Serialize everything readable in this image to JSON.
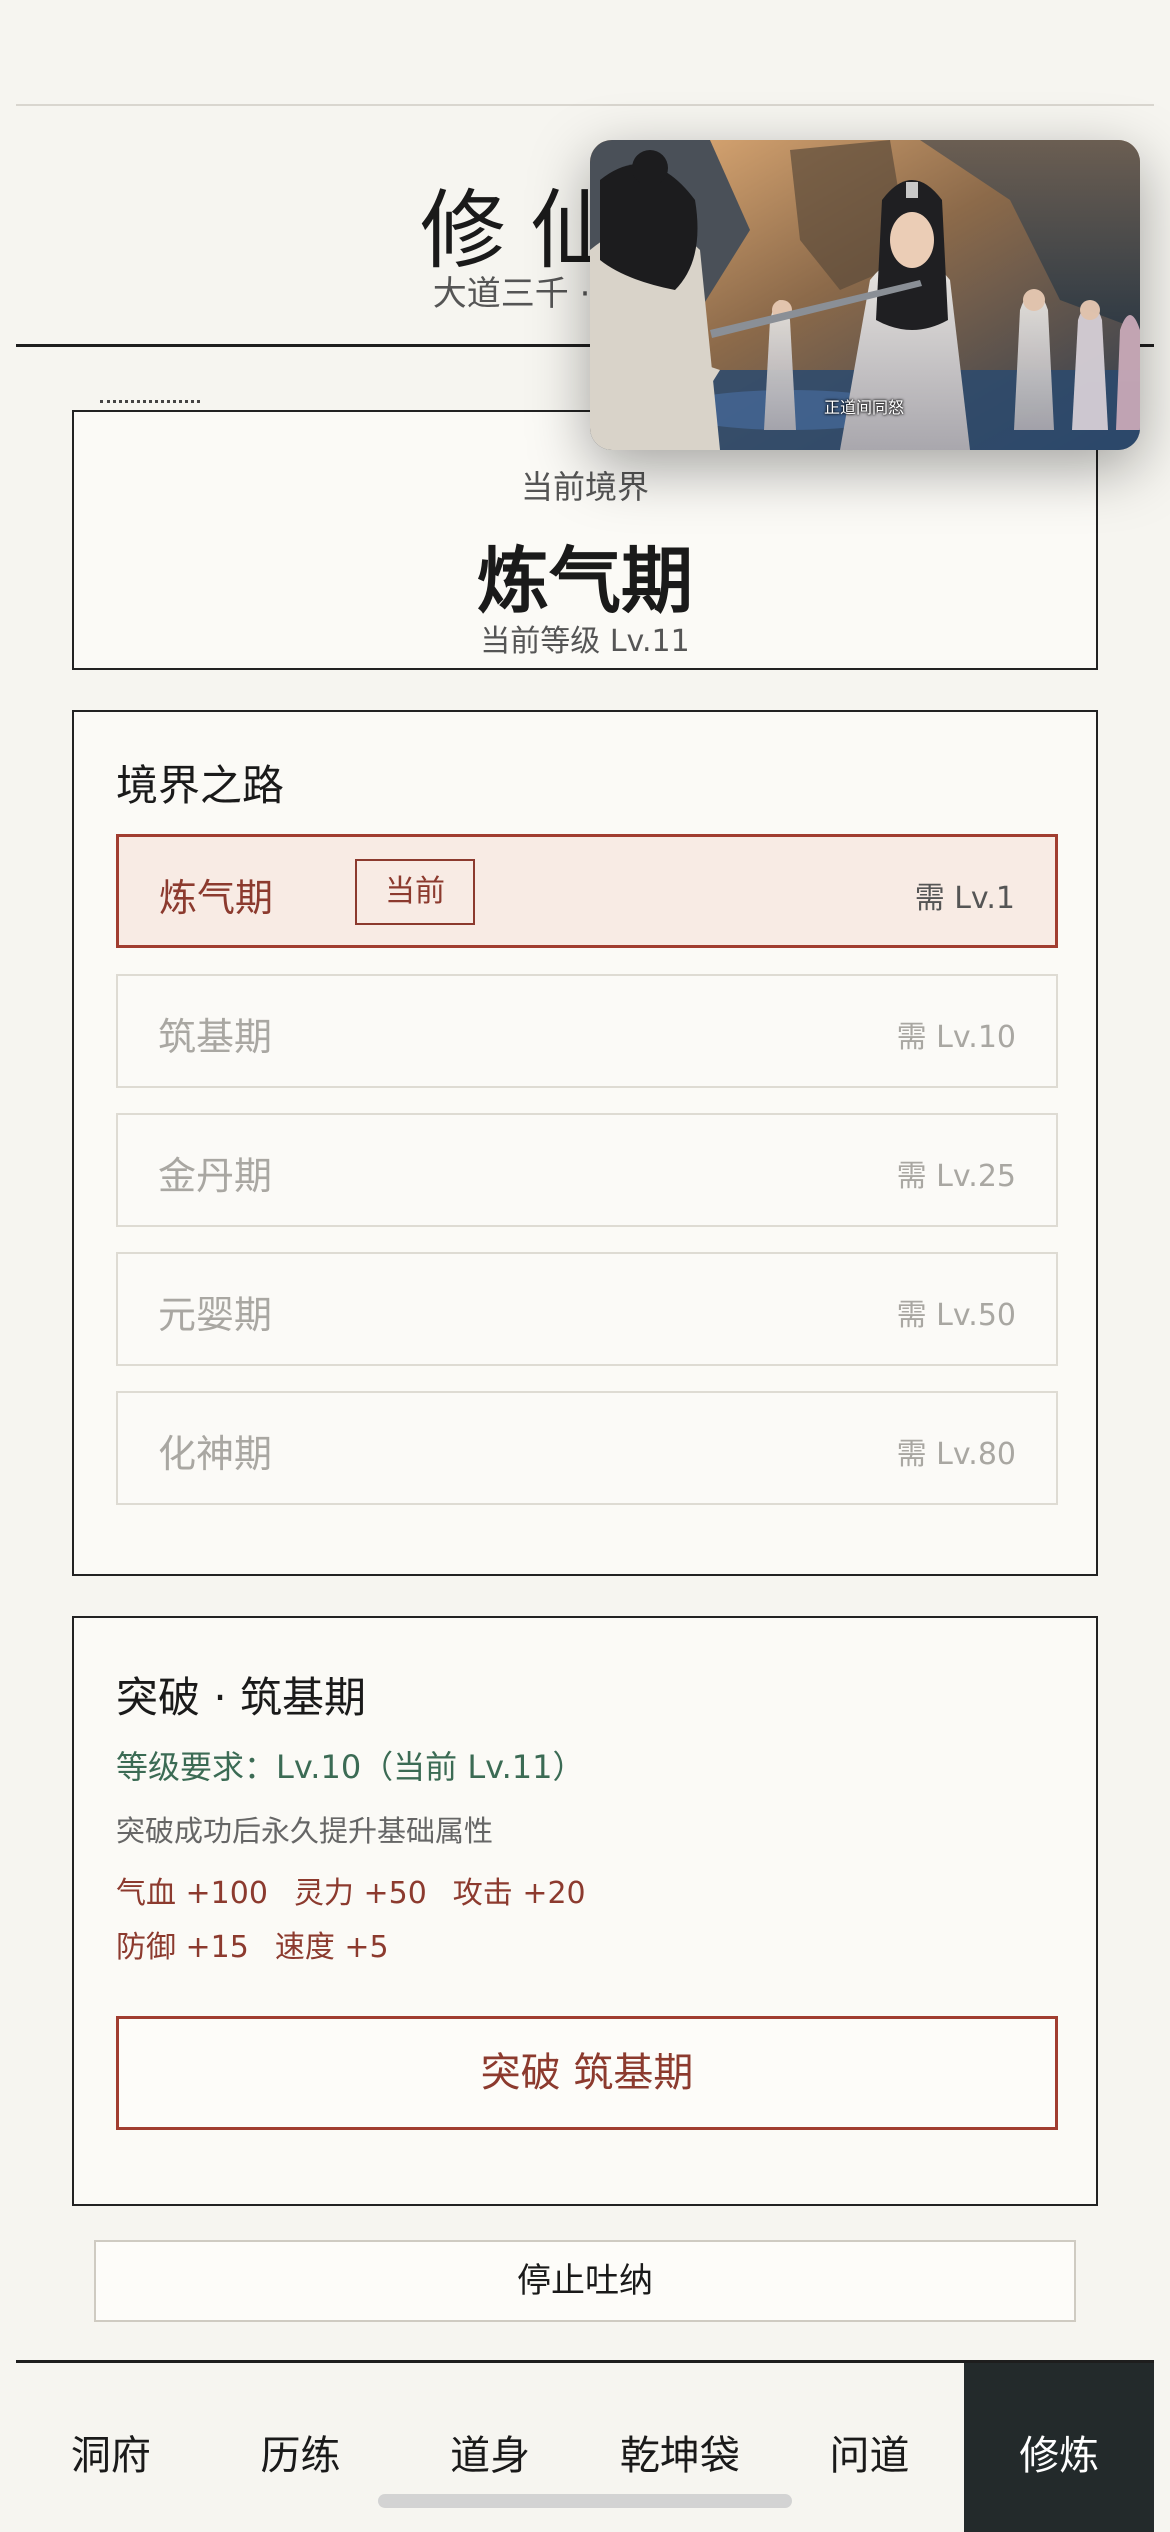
{
  "header": {
    "title": "修仙录",
    "subtitle": "大道三千 · 唯道独尊"
  },
  "current_realm": {
    "label": "当前境界",
    "name": "炼气期",
    "level": "当前等级 Lv.11"
  },
  "realm_path": {
    "title": "境界之路",
    "current_badge": "当前",
    "stages": [
      {
        "name": "炼气期",
        "req": "需 Lv.1"
      },
      {
        "name": "筑基期",
        "req": "需 Lv.10"
      },
      {
        "name": "金丹期",
        "req": "需 Lv.25"
      },
      {
        "name": "元婴期",
        "req": "需 Lv.50"
      },
      {
        "name": "化神期",
        "req": "需 Lv.80"
      }
    ]
  },
  "breakthrough": {
    "title": "突破 · 筑基期",
    "requirement": "等级要求：Lv.10（当前 Lv.11）",
    "description": "突破成功后永久提升基础属性",
    "stats_row1": [
      "气血 +100",
      "灵力 +50",
      "攻击 +20"
    ],
    "stats_row2": [
      "防御 +15",
      "速度 +5"
    ],
    "button_label": "突破 筑基期"
  },
  "stop_button_label": "停止吐纳",
  "tabs": [
    "洞府",
    "历练",
    "道身",
    "乾坤袋",
    "问道",
    "修炼"
  ],
  "video_overlay": {
    "caption": "正道间同怒"
  },
  "colors": {
    "accent_red": "#a13d30",
    "accent_green": "#3b6b54",
    "active_tab_bg": "#232a2b"
  }
}
